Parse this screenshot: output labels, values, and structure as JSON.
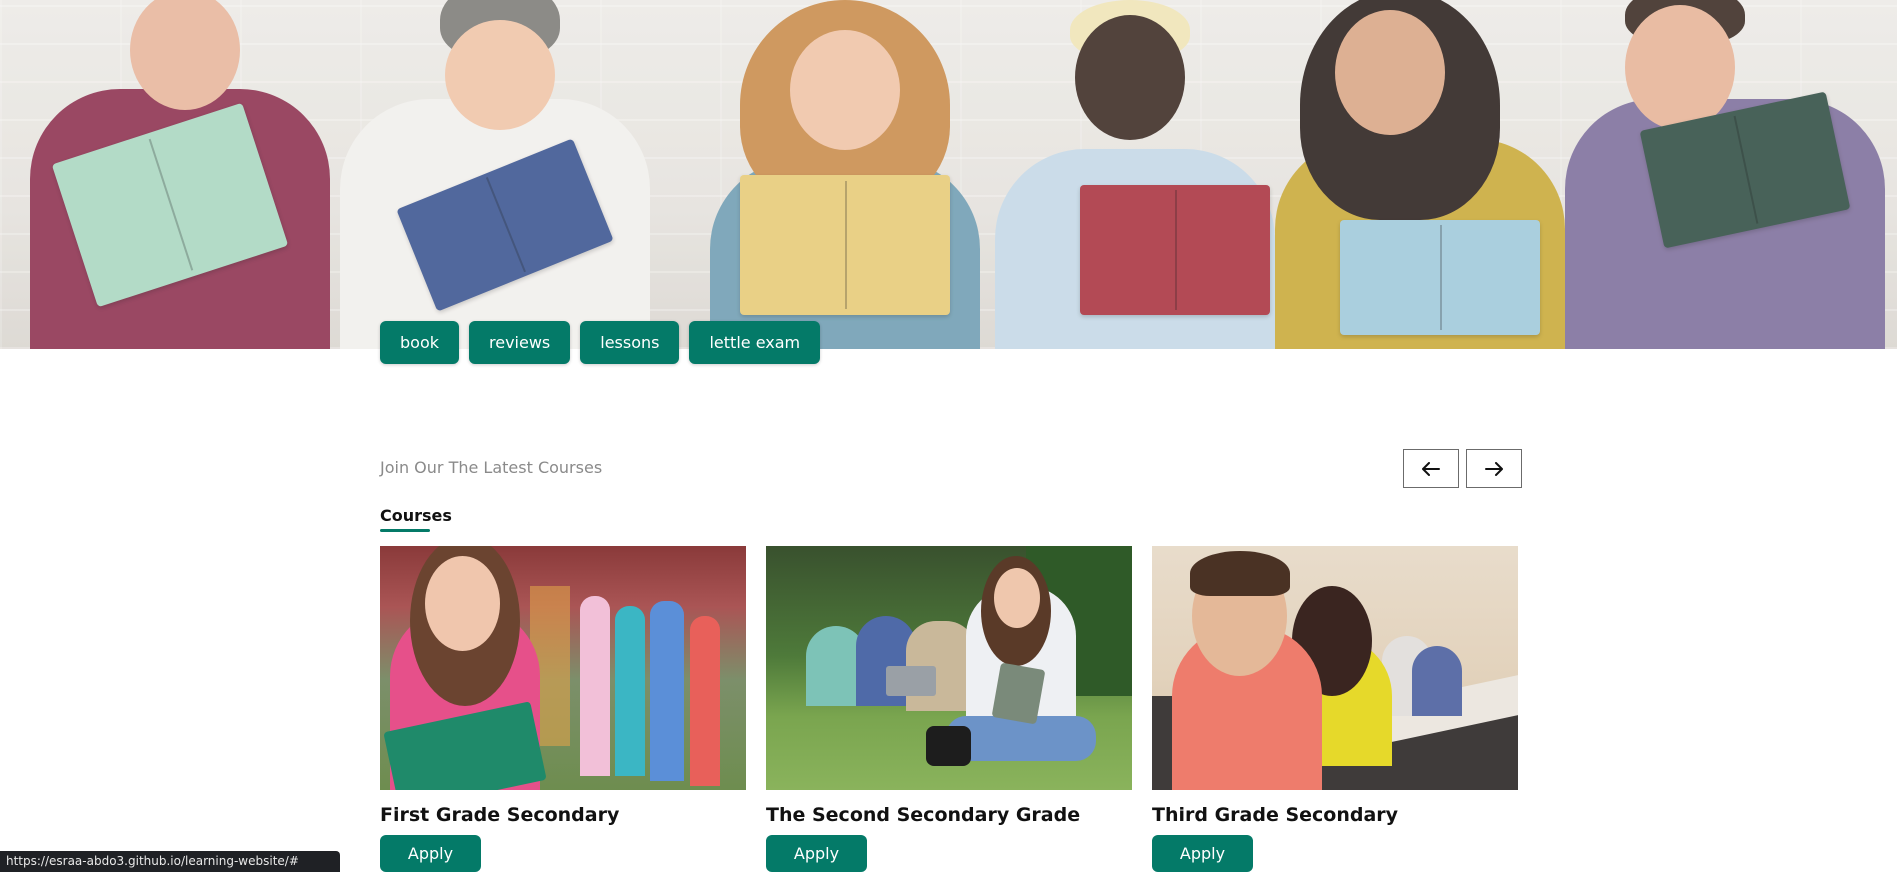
{
  "hero": {
    "tabs": [
      "book",
      "reviews",
      "lessons",
      "lettle exam"
    ]
  },
  "section": {
    "subtitle": "Join Our The Latest Courses",
    "title": "Courses"
  },
  "nav": {
    "prev_icon": "arrow-left-icon",
    "next_icon": "arrow-right-icon"
  },
  "courses": [
    {
      "name": "First Grade Secondary",
      "button": "Apply"
    },
    {
      "name": "The Second Secondary Grade",
      "button": "Apply"
    },
    {
      "name": "Third Grade Secondary",
      "button": "Apply"
    }
  ],
  "status_bar": {
    "url": "https://esraa-abdo3.github.io/learning-website/#"
  },
  "colors": {
    "accent": "#047a68",
    "status_bg": "#1f2125"
  }
}
